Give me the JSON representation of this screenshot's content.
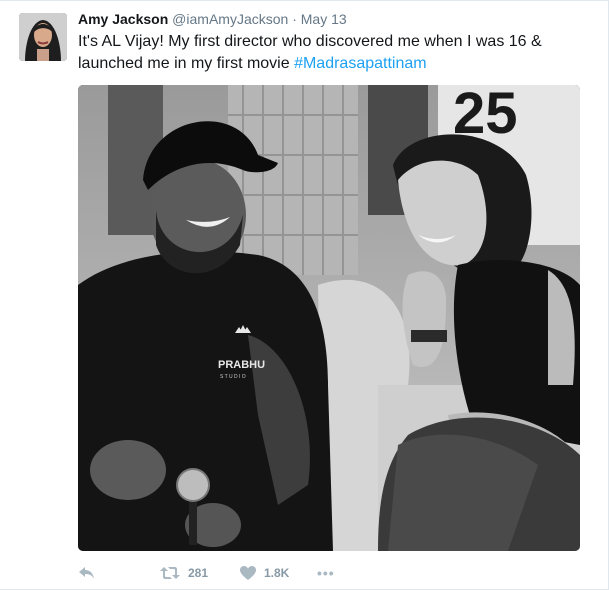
{
  "tweet": {
    "author_name": "Amy Jackson",
    "author_handle": "@iamAmyJackson",
    "separator": "·",
    "date": "May 13",
    "text": "It's AL Vijay! My first director who discovered me when I was 16 & launched me in my first movie ",
    "hashtag": "#Madrasapattinam"
  },
  "photo": {
    "shirt_text": "PRABHU",
    "shirt_subtext": "S T U D I O",
    "jersey_number": "25"
  },
  "actions": {
    "retweet_count": "281",
    "like_count": "1.8K",
    "more_label": "•••"
  },
  "colors": {
    "link": "#1da1f2",
    "muted": "#657786",
    "icon": "#aab8c2"
  }
}
